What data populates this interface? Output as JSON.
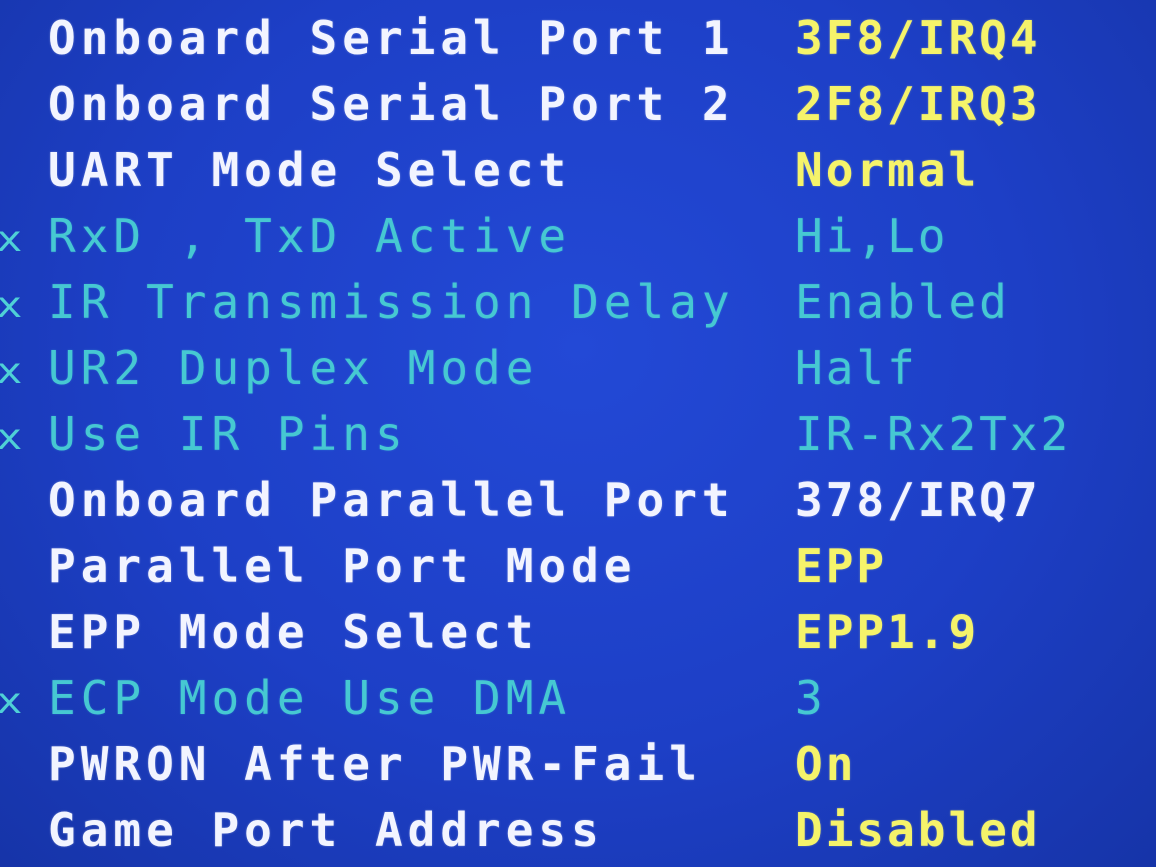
{
  "settings": [
    {
      "label": "Onboard Serial Port 1",
      "value": "3F8/IRQ4",
      "mark": "",
      "state": "active"
    },
    {
      "label": "Onboard Serial Port 2",
      "value": "2F8/IRQ3",
      "mark": "",
      "state": "active"
    },
    {
      "label": "UART Mode Select",
      "value": "Normal",
      "mark": "",
      "state": "active"
    },
    {
      "label": "RxD , TxD Active",
      "value": "Hi,Lo",
      "mark": "x",
      "state": "disabled"
    },
    {
      "label": "IR Transmission Delay",
      "value": "Enabled",
      "mark": "x",
      "state": "disabled"
    },
    {
      "label": "UR2 Duplex Mode",
      "value": "Half",
      "mark": "x",
      "state": "disabled"
    },
    {
      "label": "Use IR Pins",
      "value": "IR-Rx2Tx2",
      "mark": "x",
      "state": "disabled"
    },
    {
      "label": "Onboard Parallel Port",
      "value": "378/IRQ7",
      "mark": "",
      "state": "active"
    },
    {
      "label": "Parallel Port Mode",
      "value": "EPP",
      "mark": "",
      "state": "active"
    },
    {
      "label": "EPP Mode Select",
      "value": "EPP1.9",
      "mark": "",
      "state": "active"
    },
    {
      "label": "ECP Mode Use DMA",
      "value": "3",
      "mark": "x",
      "state": "disabled"
    },
    {
      "label": "PWRON After PWR-Fail",
      "value": "On",
      "mark": "",
      "state": "active"
    },
    {
      "label": "Game Port Address",
      "value": "Disabled",
      "mark": "",
      "state": "active"
    }
  ],
  "colors": {
    "background": "#1d3fc6",
    "label": "#f2f4ff",
    "value": "#f5f36a",
    "disabled": "#46c8d2"
  }
}
